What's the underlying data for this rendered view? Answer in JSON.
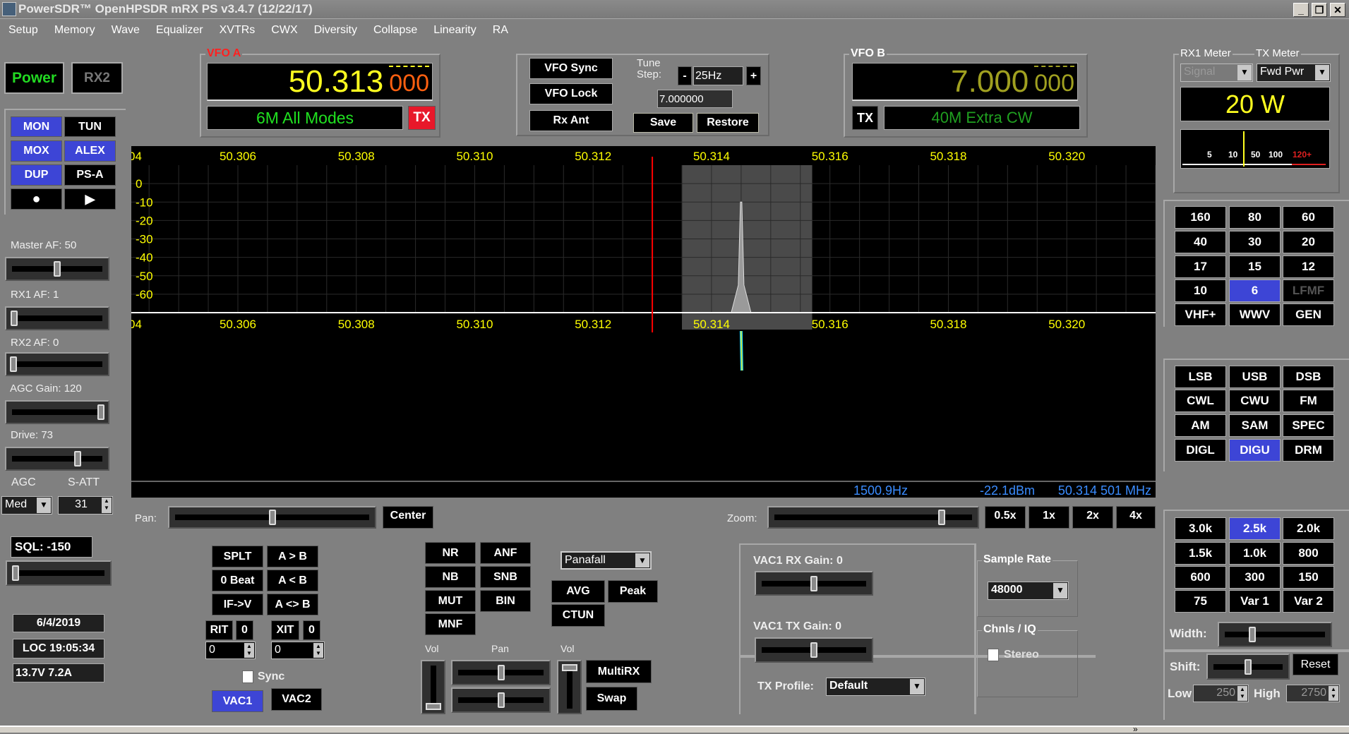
{
  "window": {
    "title": "PowerSDR™ OpenHPSDR mRX PS v3.4.7 (12/22/17)",
    "controls": [
      "_",
      "❐",
      "✕"
    ]
  },
  "menu": [
    "Setup",
    "Memory",
    "Wave",
    "Equalizer",
    "XVTRs",
    "CWX",
    "Diversity",
    "Collapse",
    "Linearity",
    "RA"
  ],
  "power": {
    "power": "Power",
    "rx2": "RX2"
  },
  "tx_buttons": {
    "mon": "MON",
    "tun": "TUN",
    "mox": "MOX",
    "alex": "ALEX",
    "dup": "DUP",
    "psa": "PS-A",
    "record": "●",
    "play": "▶"
  },
  "sliders": {
    "master_af": {
      "label": "Master AF:  50",
      "value": 50,
      "max": 100
    },
    "rx1_af": {
      "label": "RX1 AF:  1",
      "value": 1,
      "max": 100
    },
    "rx2_af": {
      "label": "RX2 AF:  0",
      "value": 0,
      "max": 100
    },
    "agc_gain": {
      "label": "AGC Gain:  120",
      "value": 120,
      "max": 120
    },
    "drive": {
      "label": "Drive:  73",
      "value": 73,
      "max": 100
    }
  },
  "agc": {
    "label": "AGC",
    "value": "Med",
    "satt_label": "S-ATT",
    "satt_value": "31"
  },
  "sql": {
    "label": "SQL:  -150",
    "value": -150
  },
  "status": {
    "date": "6/4/2019",
    "time": "LOC 19:05:34",
    "power": "13.7V 7.2A"
  },
  "vfo_a": {
    "title": "VFO A",
    "freq_main": "50.313",
    "freq_sub": "000",
    "band": "6M All Modes",
    "tx": "TX"
  },
  "vfo_ctrl": {
    "sync": "VFO Sync",
    "lock": "VFO Lock",
    "rx_ant": "Rx Ant",
    "tune_step_label": "Tune Step:",
    "minus": "-",
    "step": "25Hz",
    "plus": "+",
    "mem_freq": "7.000000",
    "save": "Save",
    "restore": "Restore"
  },
  "vfo_b": {
    "title": "VFO B",
    "freq_main": "7.000",
    "freq_sub": "000",
    "band": "40M Extra CW",
    "tx": "TX"
  },
  "meter": {
    "rx1_label": "RX1 Meter",
    "tx_label": "TX Meter",
    "rx1_mode": "Signal",
    "tx_mode": "Fwd Pwr",
    "reading": "20 W",
    "scale": [
      "5",
      "10",
      "50",
      "100",
      "120+"
    ],
    "needle_value": "12"
  },
  "panadapter": {
    "freq_ticks": [
      "50.306",
      "50.308",
      "50.310",
      "50.312",
      "50.314",
      "50.316",
      "50.318",
      "50.320"
    ],
    "left_edge_label": "04",
    "db_ticks": [
      "0",
      "-10",
      "-20",
      "-30",
      "-40",
      "-50",
      "-60"
    ],
    "xlim_mhz": [
      50.3042,
      50.3215
    ],
    "ylim_db": [
      -70,
      10
    ],
    "vfo_line_mhz": 50.313,
    "filter_mhz": [
      50.3135,
      50.3157
    ],
    "signal": {
      "peak_mhz": 50.3145,
      "peak_db": -10,
      "floor_db": -70
    },
    "readout": {
      "offset": "1500.9Hz",
      "level": "-22.1dBm",
      "freq": "50.314 501 MHz"
    },
    "colors": {
      "ticks": "#ffff00",
      "vfo": "#ff0000",
      "filter": "#4a4a4a",
      "readout": "#3a8cff"
    }
  },
  "pan": {
    "label": "Pan:",
    "center": "Center",
    "value": 50
  },
  "zoom": {
    "label": "Zoom:",
    "value": 85,
    "buttons": [
      "0.5x",
      "1x",
      "2x",
      "4x"
    ]
  },
  "split": {
    "splt": "SPLT",
    "a_to_b": "A > B",
    "zero_beat": "0 Beat",
    "b_to_a": "A < B",
    "if_v": "IF->V",
    "swap_ab": "A <> B",
    "rit": "RIT",
    "rit_val": "0",
    "rit_offset": "0",
    "xit": "XIT",
    "xit_val": "0",
    "xit_offset": "0",
    "sync": "Sync",
    "vac1": "VAC1",
    "vac2": "VAC2"
  },
  "dsp": {
    "nr": "NR",
    "anf": "ANF",
    "nb": "NB",
    "snb": "SNB",
    "mut": "MUT",
    "bin": "BIN",
    "mnf": "MNF"
  },
  "display": {
    "mode": "Panafall",
    "avg": "AVG",
    "peak": "Peak",
    "ctun": "CTUN"
  },
  "mixer": {
    "vol1": "Vol",
    "pan": "Pan",
    "vol2": "Vol",
    "multirx": "MultiRX",
    "swap": "Swap"
  },
  "vac": {
    "rx_gain": "VAC1  RX Gain:  0",
    "tx_gain": "VAC1  TX Gain:  0",
    "tx_profile_label": "TX Profile:",
    "tx_profile": "Default",
    "sample_rate_title": "Sample Rate",
    "sample_rate": "48000",
    "chnls_title": "Chnls / IQ",
    "stereo": "Stereo"
  },
  "bands": {
    "items": [
      "160",
      "80",
      "60",
      "40",
      "30",
      "20",
      "17",
      "15",
      "12",
      "10",
      "6",
      "LFMF",
      "VHF+",
      "WWV",
      "GEN"
    ],
    "selected": "6",
    "disabled": [
      "LFMF"
    ]
  },
  "modes": {
    "items": [
      "LSB",
      "USB",
      "DSB",
      "CWL",
      "CWU",
      "FM",
      "AM",
      "SAM",
      "SPEC",
      "DIGL",
      "DIGU",
      "DRM"
    ],
    "selected": "DIGU"
  },
  "filters": {
    "items": [
      "3.0k",
      "2.5k",
      "2.0k",
      "1.5k",
      "1.0k",
      "800",
      "600",
      "300",
      "150",
      "75",
      "Var 1",
      "Var 2"
    ],
    "selected": "2.5k",
    "width_label": "Width:",
    "shift_label": "Shift:",
    "reset": "Reset",
    "low_label": "Low",
    "low": "250",
    "high_label": "High",
    "high": "2750"
  },
  "taskbar": {
    "overflow": "»"
  }
}
